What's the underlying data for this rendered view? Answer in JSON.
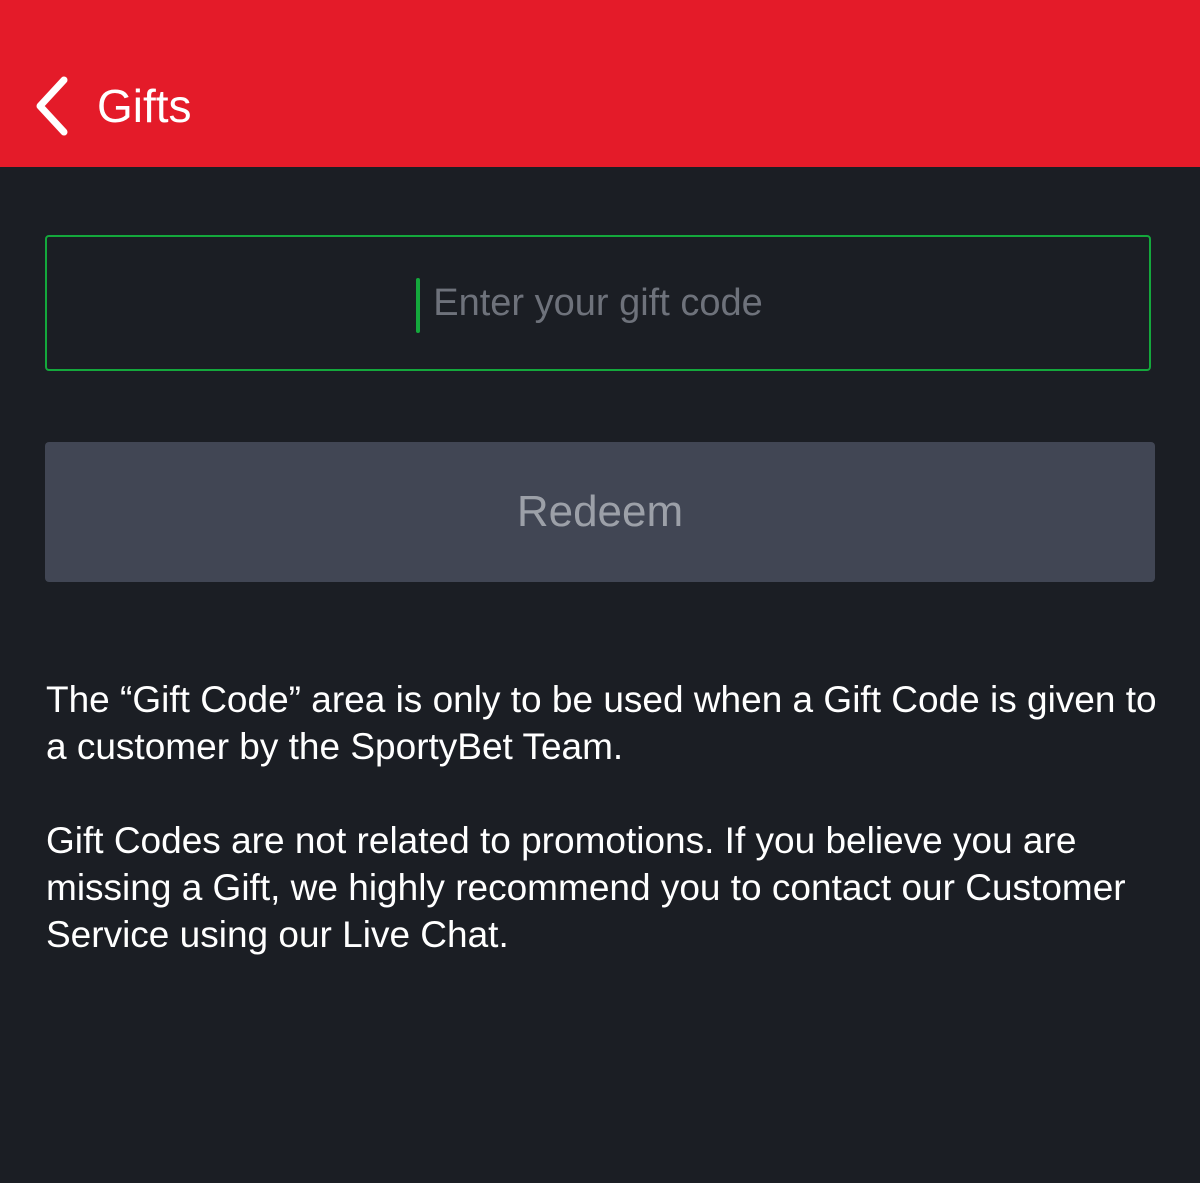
{
  "header": {
    "title": "Gifts",
    "background_color": "#e41b29",
    "back_icon": "chevron-left-icon"
  },
  "gift_code": {
    "value": "",
    "placeholder": "Enter your gift code",
    "focus_color": "#14a83c"
  },
  "redeem_button": {
    "label": "Redeem",
    "enabled": false,
    "background_color": "#414654"
  },
  "info": {
    "paragraph_1": "The “Gift Code” area is only to be used when a Gift Code is given to a customer by the SportyBet Team.",
    "paragraph_2": "Gift Codes are not related to promotions. If you believe you are missing a Gift, we highly recommend you to contact our Customer Service using our Live Chat."
  },
  "theme": {
    "page_background": "#1b1e24",
    "text_color": "#ffffff"
  }
}
